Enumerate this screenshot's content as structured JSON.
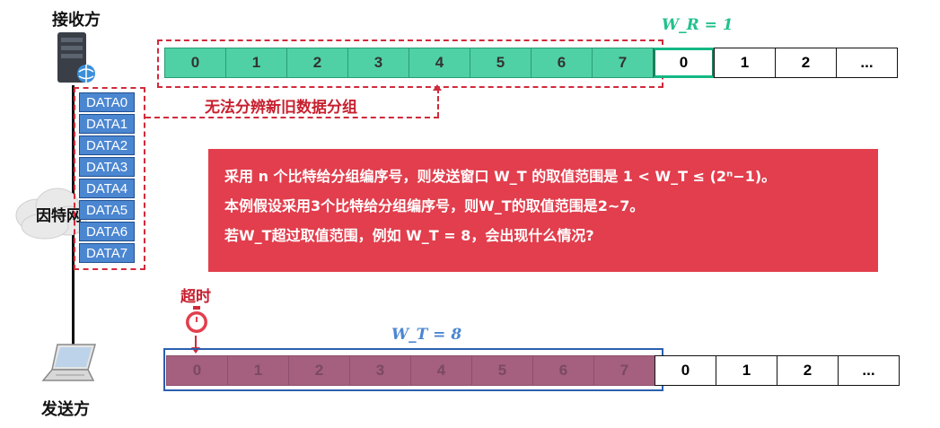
{
  "receiver": {
    "label": "接收方"
  },
  "sender": {
    "label": "发送方"
  },
  "internet": {
    "label": "因特网"
  },
  "receiver_window": {
    "label": "W_R = 1"
  },
  "top_row": {
    "old_cells": [
      "0",
      "1",
      "2",
      "3",
      "4",
      "5",
      "6",
      "7"
    ],
    "new_cells": [
      "0",
      "1",
      "2",
      "..."
    ]
  },
  "ambiguity_label": "无法分辨新旧数据分组",
  "data_packets": [
    "DATA0",
    "DATA1",
    "DATA2",
    "DATA3",
    "DATA4",
    "DATA5",
    "DATA6",
    "DATA7"
  ],
  "info": {
    "line1": "采用 n 个比特给分组编序号，则发送窗口 W_T 的取值范围是 1 < W_T ≤ (2ⁿ−1)。",
    "line2": "本例假设采用3个比特给分组编序号，则W_T的取值范围是2~7。",
    "line3": "若W_T超过取值范围，例如 W_T = 8，会出现什么情况?"
  },
  "timeout": {
    "label": "超时"
  },
  "sender_window": {
    "label": "W_T = 8"
  },
  "bottom_row": {
    "window_cells": [
      "0",
      "1",
      "2",
      "3",
      "4",
      "5",
      "6",
      "7"
    ],
    "after_cells": [
      "0",
      "1",
      "2",
      "..."
    ]
  },
  "colors": {
    "window_green": "#4fd1a5",
    "window_purple": "#a4607e",
    "alert_red": "#e23e4d",
    "data_blue": "#4b86d1"
  }
}
